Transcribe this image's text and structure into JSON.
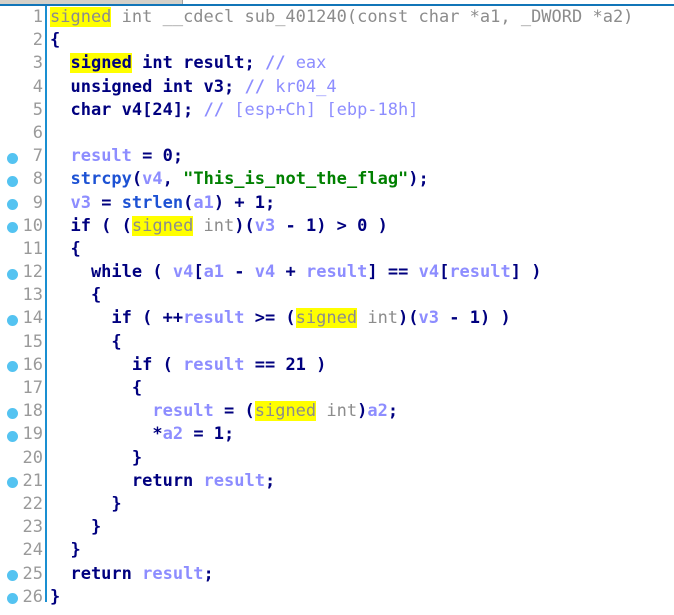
{
  "window": {
    "app": "IDA Pro - Hex-Rays Decompiler",
    "view": "Pseudocode",
    "tab_label": ""
  },
  "editor": {
    "highlight_term": "signed",
    "highlight_color": "#ffff00",
    "gutter_divider_color": "#1a8fd1",
    "marker_dot_color": "#54c3f1",
    "line_number_color": "#9a9a9a",
    "palette": {
      "type": "#8c8c8c",
      "keyword": "#00007f",
      "variable": "#8d8dff",
      "call": "#1d52d4",
      "string": "#008000",
      "comment": "#8d8dff",
      "background": "#ffffff"
    },
    "function_name": "sub_401240",
    "first_line": 1,
    "last_line": 26,
    "total_lines": 26
  },
  "lines": [
    {
      "n": "1",
      "marker": false,
      "text": "signed int __cdecl sub_401240(const char *a1, _DWORD *a2)"
    },
    {
      "n": "2",
      "marker": false,
      "text": "{"
    },
    {
      "n": "3",
      "marker": false,
      "text": "  signed int result; // eax"
    },
    {
      "n": "4",
      "marker": false,
      "text": "  unsigned int v3; // kr04_4"
    },
    {
      "n": "5",
      "marker": false,
      "text": "  char v4[24]; // [esp+Ch] [ebp-18h]"
    },
    {
      "n": "6",
      "marker": false,
      "text": ""
    },
    {
      "n": "7",
      "marker": true,
      "text": "  result = 0;"
    },
    {
      "n": "8",
      "marker": true,
      "text": "  strcpy(v4, \"This_is_not_the_flag\");"
    },
    {
      "n": "9",
      "marker": true,
      "text": "  v3 = strlen(a1) + 1;"
    },
    {
      "n": "10",
      "marker": true,
      "text": "  if ( (signed int)(v3 - 1) > 0 )"
    },
    {
      "n": "11",
      "marker": false,
      "text": "  {"
    },
    {
      "n": "12",
      "marker": true,
      "text": "    while ( v4[a1 - v4 + result] == v4[result] )"
    },
    {
      "n": "13",
      "marker": false,
      "text": "    {"
    },
    {
      "n": "14",
      "marker": true,
      "text": "      if ( ++result >= (signed int)(v3 - 1) )"
    },
    {
      "n": "15",
      "marker": false,
      "text": "      {"
    },
    {
      "n": "16",
      "marker": true,
      "text": "        if ( result == 21 )"
    },
    {
      "n": "17",
      "marker": false,
      "text": "        {"
    },
    {
      "n": "18",
      "marker": true,
      "text": "          result = (signed int)a2;"
    },
    {
      "n": "19",
      "marker": true,
      "text": "          *a2 = 1;"
    },
    {
      "n": "20",
      "marker": false,
      "text": "        }"
    },
    {
      "n": "21",
      "marker": true,
      "text": "        return result;"
    },
    {
      "n": "22",
      "marker": false,
      "text": "      }"
    },
    {
      "n": "23",
      "marker": false,
      "text": "    }"
    },
    {
      "n": "24",
      "marker": false,
      "text": "  }"
    },
    {
      "n": "25",
      "marker": true,
      "text": "  return result;"
    },
    {
      "n": "26",
      "marker": true,
      "text": "}"
    }
  ],
  "tokens": {
    "line1": [
      {
        "t": "signed",
        "c": "t-type",
        "hl": true
      },
      {
        "t": " int __cdecl ",
        "c": "t-type"
      },
      {
        "t": "sub_401240",
        "c": "t-fn"
      },
      {
        "t": "(const char *a1, _DWORD *a2)",
        "c": "t-type"
      }
    ],
    "line2": [
      {
        "t": "{",
        "c": "t-punct"
      }
    ],
    "line3": [
      {
        "t": "  ",
        "c": "t-punct"
      },
      {
        "t": "signed",
        "c": "t-kw",
        "hl": true
      },
      {
        "t": " int result; ",
        "c": "t-kw"
      },
      {
        "t": "// ",
        "c": "t-cmt"
      },
      {
        "t": "eax",
        "c": "t-cmtx"
      }
    ],
    "line4": [
      {
        "t": "  unsigned int v3; ",
        "c": "t-kw"
      },
      {
        "t": "// ",
        "c": "t-cmt"
      },
      {
        "t": "kr04_4",
        "c": "t-cmtx"
      }
    ],
    "line5": [
      {
        "t": "  char v4[24]; ",
        "c": "t-kw"
      },
      {
        "t": "// ",
        "c": "t-cmt"
      },
      {
        "t": "[esp+Ch] [ebp-18h]",
        "c": "t-cmtx"
      }
    ],
    "line6": [],
    "line7": [
      {
        "t": "  ",
        "c": "t-punct"
      },
      {
        "t": "result",
        "c": "t-var"
      },
      {
        "t": " = ",
        "c": "t-punct"
      },
      {
        "t": "0",
        "c": "t-num"
      },
      {
        "t": ";",
        "c": "t-punct"
      }
    ],
    "line8": [
      {
        "t": "  ",
        "c": "t-punct"
      },
      {
        "t": "strcpy",
        "c": "t-call"
      },
      {
        "t": "(",
        "c": "t-punct"
      },
      {
        "t": "v4",
        "c": "t-var"
      },
      {
        "t": ", ",
        "c": "t-punct"
      },
      {
        "t": "\"This_is_not_the_flag\"",
        "c": "t-str"
      },
      {
        "t": ");",
        "c": "t-punct"
      }
    ],
    "line9": [
      {
        "t": "  ",
        "c": "t-punct"
      },
      {
        "t": "v3",
        "c": "t-var"
      },
      {
        "t": " = ",
        "c": "t-punct"
      },
      {
        "t": "strlen",
        "c": "t-call"
      },
      {
        "t": "(",
        "c": "t-punct"
      },
      {
        "t": "a1",
        "c": "t-var"
      },
      {
        "t": ") + ",
        "c": "t-punct"
      },
      {
        "t": "1",
        "c": "t-num"
      },
      {
        "t": ";",
        "c": "t-punct"
      }
    ],
    "line10": [
      {
        "t": "  if ( (",
        "c": "t-kw"
      },
      {
        "t": "signed",
        "c": "t-type",
        "hl": true
      },
      {
        "t": " int",
        "c": "t-type"
      },
      {
        "t": ")(",
        "c": "t-punct"
      },
      {
        "t": "v3",
        "c": "t-var"
      },
      {
        "t": " - ",
        "c": "t-punct"
      },
      {
        "t": "1",
        "c": "t-num"
      },
      {
        "t": ") > ",
        "c": "t-punct"
      },
      {
        "t": "0",
        "c": "t-num"
      },
      {
        "t": " )",
        "c": "t-punct"
      }
    ],
    "line11": [
      {
        "t": "  {",
        "c": "t-punct"
      }
    ],
    "line12": [
      {
        "t": "    while ( ",
        "c": "t-kw"
      },
      {
        "t": "v4",
        "c": "t-var"
      },
      {
        "t": "[",
        "c": "t-punct"
      },
      {
        "t": "a1",
        "c": "t-var"
      },
      {
        "t": " - ",
        "c": "t-punct"
      },
      {
        "t": "v4",
        "c": "t-var"
      },
      {
        "t": " + ",
        "c": "t-punct"
      },
      {
        "t": "result",
        "c": "t-var"
      },
      {
        "t": "] == ",
        "c": "t-punct"
      },
      {
        "t": "v4",
        "c": "t-var"
      },
      {
        "t": "[",
        "c": "t-punct"
      },
      {
        "t": "result",
        "c": "t-var"
      },
      {
        "t": "] )",
        "c": "t-punct"
      }
    ],
    "line13": [
      {
        "t": "    {",
        "c": "t-punct"
      }
    ],
    "line14": [
      {
        "t": "      if ( ++",
        "c": "t-kw"
      },
      {
        "t": "result",
        "c": "t-var"
      },
      {
        "t": " >= (",
        "c": "t-punct"
      },
      {
        "t": "signed",
        "c": "t-type",
        "hl": true
      },
      {
        "t": " int",
        "c": "t-type"
      },
      {
        "t": ")(",
        "c": "t-punct"
      },
      {
        "t": "v3",
        "c": "t-var"
      },
      {
        "t": " - ",
        "c": "t-punct"
      },
      {
        "t": "1",
        "c": "t-num"
      },
      {
        "t": ") )",
        "c": "t-punct"
      }
    ],
    "line15": [
      {
        "t": "      {",
        "c": "t-punct"
      }
    ],
    "line16": [
      {
        "t": "        if ( ",
        "c": "t-kw"
      },
      {
        "t": "result",
        "c": "t-var"
      },
      {
        "t": " == ",
        "c": "t-punct"
      },
      {
        "t": "21",
        "c": "t-num"
      },
      {
        "t": " )",
        "c": "t-punct"
      }
    ],
    "line17": [
      {
        "t": "        {",
        "c": "t-punct"
      }
    ],
    "line18": [
      {
        "t": "          ",
        "c": "t-punct"
      },
      {
        "t": "result",
        "c": "t-var"
      },
      {
        "t": " = (",
        "c": "t-punct"
      },
      {
        "t": "signed",
        "c": "t-type",
        "hl": true
      },
      {
        "t": " int",
        "c": "t-type"
      },
      {
        "t": ")",
        "c": "t-punct"
      },
      {
        "t": "a2",
        "c": "t-var"
      },
      {
        "t": ";",
        "c": "t-punct"
      }
    ],
    "line19": [
      {
        "t": "          *",
        "c": "t-punct"
      },
      {
        "t": "a2",
        "c": "t-var"
      },
      {
        "t": " = ",
        "c": "t-punct"
      },
      {
        "t": "1",
        "c": "t-num"
      },
      {
        "t": ";",
        "c": "t-punct"
      }
    ],
    "line20": [
      {
        "t": "        }",
        "c": "t-punct"
      }
    ],
    "line21": [
      {
        "t": "        return ",
        "c": "t-kw"
      },
      {
        "t": "result",
        "c": "t-var"
      },
      {
        "t": ";",
        "c": "t-punct"
      }
    ],
    "line22": [
      {
        "t": "      }",
        "c": "t-punct"
      }
    ],
    "line23": [
      {
        "t": "    }",
        "c": "t-punct"
      }
    ],
    "line24": [
      {
        "t": "  }",
        "c": "t-punct"
      }
    ],
    "line25": [
      {
        "t": "  return ",
        "c": "t-kw"
      },
      {
        "t": "result",
        "c": "t-var"
      },
      {
        "t": ";",
        "c": "t-punct"
      }
    ],
    "line26": [
      {
        "t": "}",
        "c": "t-punct"
      }
    ]
  }
}
